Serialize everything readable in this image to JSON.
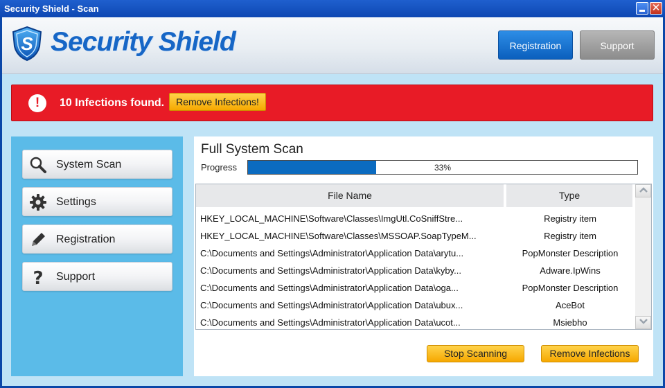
{
  "window": {
    "title": "Security Shield - Scan"
  },
  "header": {
    "logo_text": "Security Shield",
    "registration_label": "Registration",
    "support_label": "Support"
  },
  "alert": {
    "message": "10 Infections found.",
    "button_label": "Remove Infections!"
  },
  "sidebar": {
    "items": [
      {
        "label": "System Scan",
        "icon": "magnifier-icon"
      },
      {
        "label": "Settings",
        "icon": "gear-icon"
      },
      {
        "label": "Registration",
        "icon": "pencil-icon"
      },
      {
        "label": "Support",
        "icon": "question-icon"
      }
    ]
  },
  "scan": {
    "title": "Full System Scan",
    "progress_label": "Progress",
    "progress_percent": 33,
    "progress_text": "33%",
    "columns": [
      "File Name",
      "Type"
    ],
    "rows": [
      {
        "file": "HKEY_LOCAL_MACHINE\\Software\\Classes\\ImgUtl.CoSniffStre...",
        "type": "Registry item"
      },
      {
        "file": "HKEY_LOCAL_MACHINE\\Software\\Classes\\MSSOAP.SoapTypeM...",
        "type": "Registry item"
      },
      {
        "file": "C:\\Documents and Settings\\Administrator\\Application Data\\arytu...",
        "type": "PopMonster Description"
      },
      {
        "file": "C:\\Documents and Settings\\Administrator\\Application Data\\kyby...",
        "type": "Adware.IpWins"
      },
      {
        "file": "C:\\Documents and Settings\\Administrator\\Application Data\\oga...",
        "type": "PopMonster Description"
      },
      {
        "file": "C:\\Documents and Settings\\Administrator\\Application Data\\ubux...",
        "type": "AceBot"
      },
      {
        "file": "C:\\Documents and Settings\\Administrator\\Application Data\\ucot...",
        "type": "Msiebho"
      }
    ],
    "stop_label": "Stop Scanning",
    "remove_label": "Remove Infections"
  },
  "colors": {
    "accent_blue": "#0b6bc0",
    "alert_red": "#e81b26",
    "button_yellow": "#f6a800",
    "sidebar_blue": "#5bbbe8"
  }
}
